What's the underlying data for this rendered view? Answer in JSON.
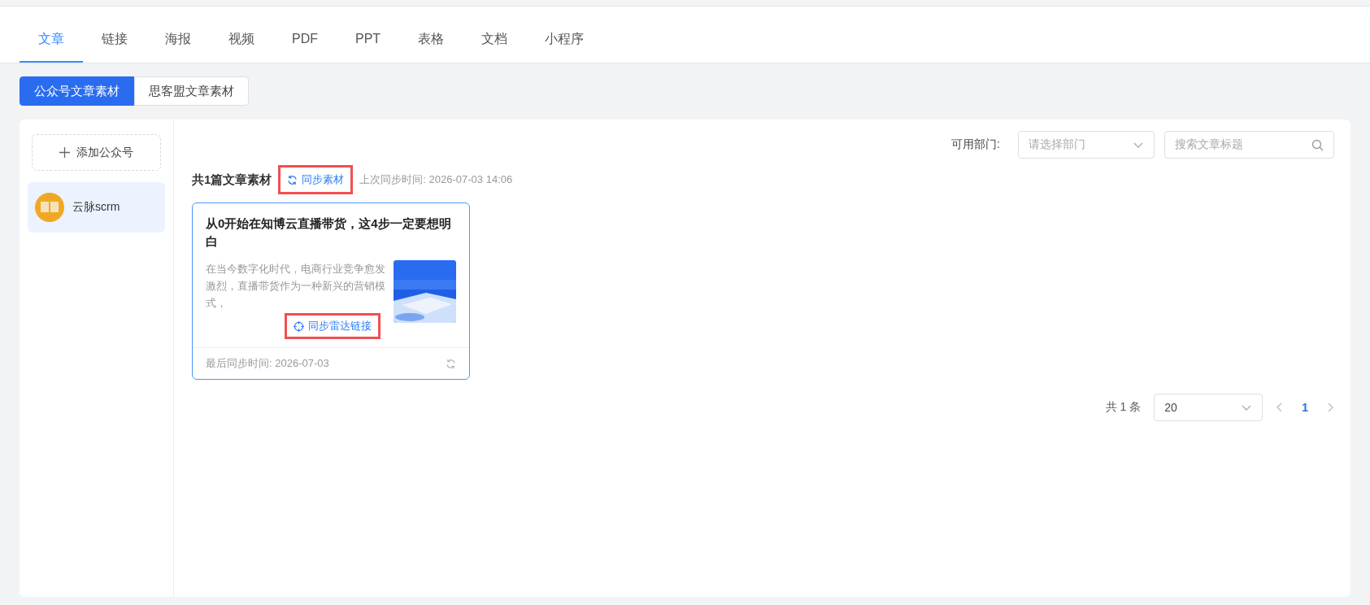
{
  "nav_tabs": [
    {
      "label": "文章",
      "selected": true
    },
    {
      "label": "链接",
      "selected": false
    },
    {
      "label": "海报",
      "selected": false
    },
    {
      "label": "视频",
      "selected": false
    },
    {
      "label": "PDF",
      "selected": false
    },
    {
      "label": "PPT",
      "selected": false
    },
    {
      "label": "表格",
      "selected": false
    },
    {
      "label": "文档",
      "selected": false
    },
    {
      "label": "小程序",
      "selected": false
    }
  ],
  "source_tabs": [
    {
      "label": "公众号文章素材",
      "selected": true
    },
    {
      "label": "思客盟文章素材",
      "selected": false
    }
  ],
  "sidebar": {
    "add_button": "添加公众号",
    "accounts": [
      {
        "name": "云脉scrm",
        "selected": true
      }
    ]
  },
  "filters": {
    "department_label": "可用部门:",
    "department_placeholder": "请选择部门",
    "search_placeholder": "搜索文章标题"
  },
  "summary": {
    "count": "共1篇文章素材",
    "sync_button": {
      "label": "同步素材",
      "highlighted": true
    },
    "last_sync": "上次同步时间: 2026-07-03 14:06"
  },
  "articles": [
    {
      "title": "从0开始在知博云直播带货，这4步一定要想明白",
      "excerpt": "在当今数字化时代，电商行业竞争愈发激烈，直播带货作为一种新兴的营销模式，",
      "radar_button": {
        "label": "同步雷达链接",
        "highlighted": true
      },
      "synced": "最后同步时间: 2026-07-03"
    }
  ],
  "pagination": {
    "total": "共 1 条",
    "page_size": "20",
    "pages": [
      {
        "label": "1",
        "selected": true
      }
    ]
  }
}
